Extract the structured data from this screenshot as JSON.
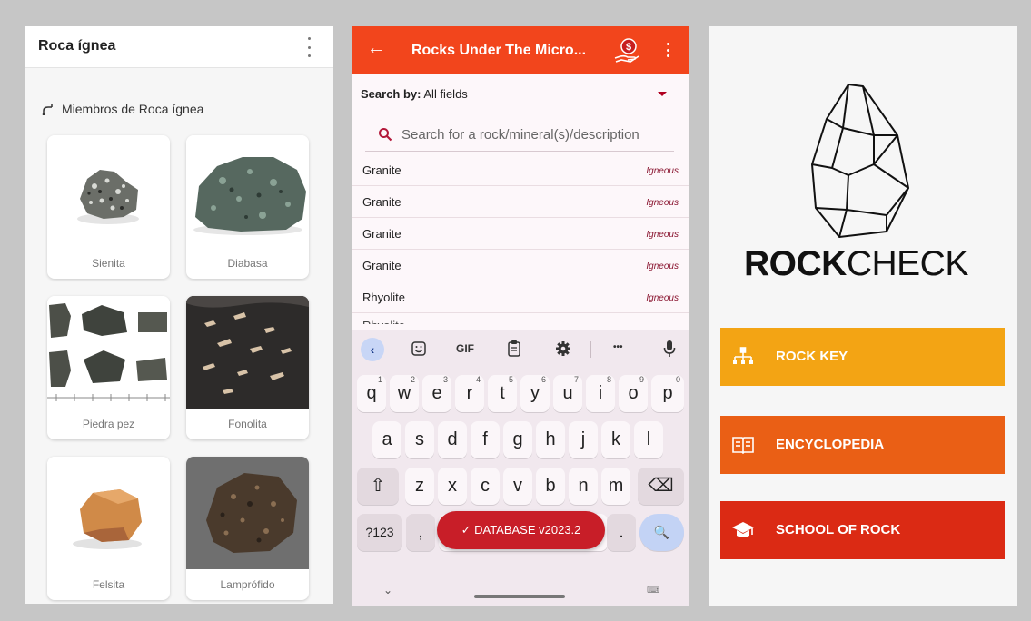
{
  "panel1": {
    "title": "Roca ígnea",
    "section_label": "Miembros de Roca ígnea",
    "cards": [
      {
        "name": "Sienita"
      },
      {
        "name": "Diabasa"
      },
      {
        "name": "Piedra pez"
      },
      {
        "name": "Fonolita"
      },
      {
        "name": "Felsita"
      },
      {
        "name": "Lamprófido"
      }
    ]
  },
  "panel2": {
    "app_title": "Rocks Under The Micro...",
    "search_by_label": "Search by:",
    "search_by_value": "All fields",
    "search_placeholder": "Search for a rock/mineral(s)/description",
    "results": [
      {
        "name": "Granite",
        "type": "Igneous"
      },
      {
        "name": "Granite",
        "type": "Igneous"
      },
      {
        "name": "Granite",
        "type": "Igneous"
      },
      {
        "name": "Granite",
        "type": "Igneous"
      },
      {
        "name": "Rhyolite",
        "type": "Igneous"
      }
    ],
    "partial_row": "Rhyolite",
    "keyboard": {
      "gif_label": "GIF",
      "more_label": "•••",
      "row1": [
        {
          "k": "q",
          "n": "1"
        },
        {
          "k": "w",
          "n": "2"
        },
        {
          "k": "e",
          "n": "3"
        },
        {
          "k": "r",
          "n": "4"
        },
        {
          "k": "t",
          "n": "5"
        },
        {
          "k": "y",
          "n": "6"
        },
        {
          "k": "u",
          "n": "7"
        },
        {
          "k": "i",
          "n": "8"
        },
        {
          "k": "o",
          "n": "9"
        },
        {
          "k": "p",
          "n": "0"
        }
      ],
      "row2": [
        "a",
        "s",
        "d",
        "f",
        "g",
        "h",
        "j",
        "k",
        "l"
      ],
      "row3": [
        "z",
        "x",
        "c",
        "v",
        "b",
        "n",
        "m"
      ],
      "sym_label": "?123",
      "comma": ",",
      "period": ".",
      "shift": "⇧",
      "backspace": "⌫",
      "search": "🔍"
    },
    "toast": "✓  DATABASE v2023.2"
  },
  "panel3": {
    "brand_bold": "ROCK",
    "brand_light": "CHECK",
    "buttons": [
      {
        "label": "ROCK KEY",
        "color": "#f3a414",
        "icon": "hierarchy-icon"
      },
      {
        "label": "ENCYCLOPEDIA",
        "color": "#ea5f15",
        "icon": "book-icon"
      },
      {
        "label": "SCHOOL OF ROCK",
        "color": "#db2a14",
        "icon": "graduation-cap-icon"
      }
    ]
  },
  "colors": {
    "accent_red": "#f2451c",
    "igneous_tag": "#8a1530",
    "toast": "#c81e28"
  }
}
